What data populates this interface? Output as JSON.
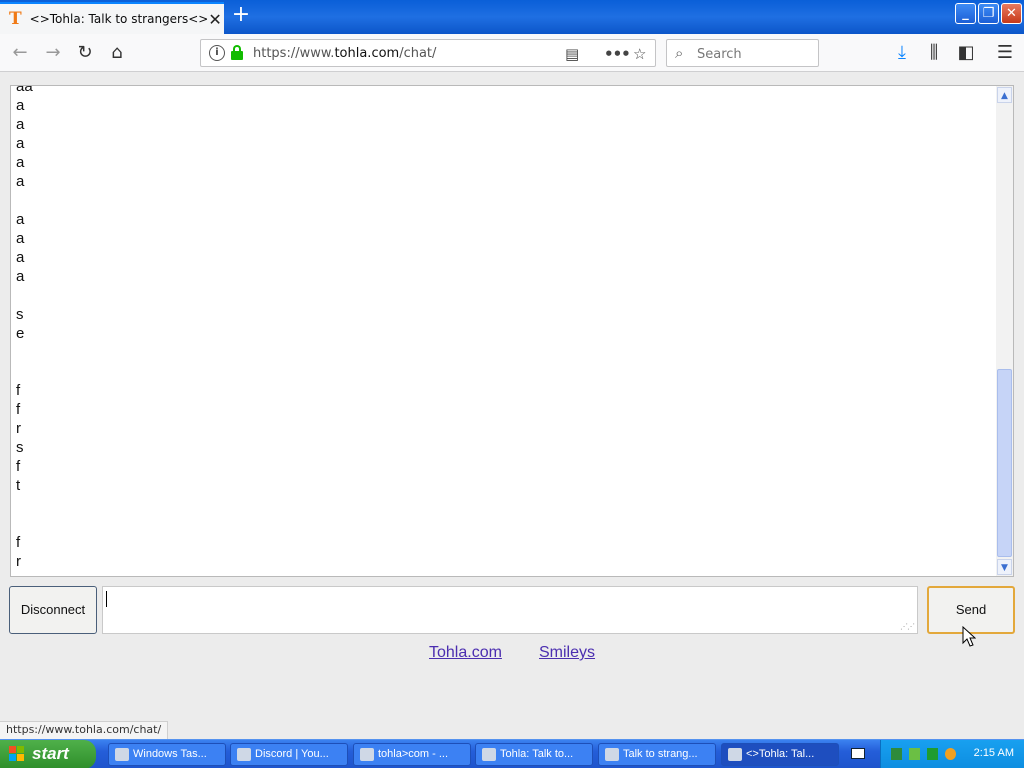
{
  "browser": {
    "tab": {
      "title": "<>Tohla: Talk to strangers<>",
      "favicon_letter": "T"
    },
    "nav": {
      "url_prefix": "https://www.",
      "url_domain": "tohla.com",
      "url_path": "/chat/",
      "search_placeholder": "Search"
    },
    "status_link": "https://www.tohla.com/chat/"
  },
  "icons": {
    "back": "back-arrow-icon",
    "forward": "forward-arrow-icon",
    "reload": "reload-icon",
    "home": "home-icon",
    "info": "info-icon",
    "lock": "lock-icon",
    "reader": "reader-view-icon",
    "more": "more-icon",
    "bookmark": "bookmark-star-icon",
    "download": "download-icon",
    "library": "library-icon",
    "sidebar": "sidebar-icon",
    "menu": "hamburger-menu-icon"
  },
  "chat": {
    "lines": [
      "aa",
      "a",
      "a",
      "a",
      "a",
      "a",
      "",
      "a",
      "a",
      "a",
      "a",
      "",
      "s",
      "e",
      "",
      "",
      "f",
      "f",
      "r",
      "s",
      "f",
      "t",
      "",
      "",
      "f",
      "r"
    ]
  },
  "controls": {
    "disconnect_label": "Disconnect",
    "message_value": "",
    "send_label": "Send"
  },
  "footer_links": {
    "tohla": "Tohla.com",
    "smileys": "Smileys"
  },
  "taskbar": {
    "start_label": "start",
    "items": [
      {
        "label": "Windows Tas..."
      },
      {
        "label": "Discord | You..."
      },
      {
        "label": "tohla>com - ..."
      },
      {
        "label": "Tohla: Talk to..."
      },
      {
        "label": "Talk to strang..."
      },
      {
        "label": "<>Tohla: Tal..."
      }
    ],
    "clock": "2:15 AM"
  },
  "colors": {
    "accent": "#0a84ff",
    "favicon": "#f07a16",
    "link": "#4b2eb0",
    "send_border": "#e3a83b"
  }
}
